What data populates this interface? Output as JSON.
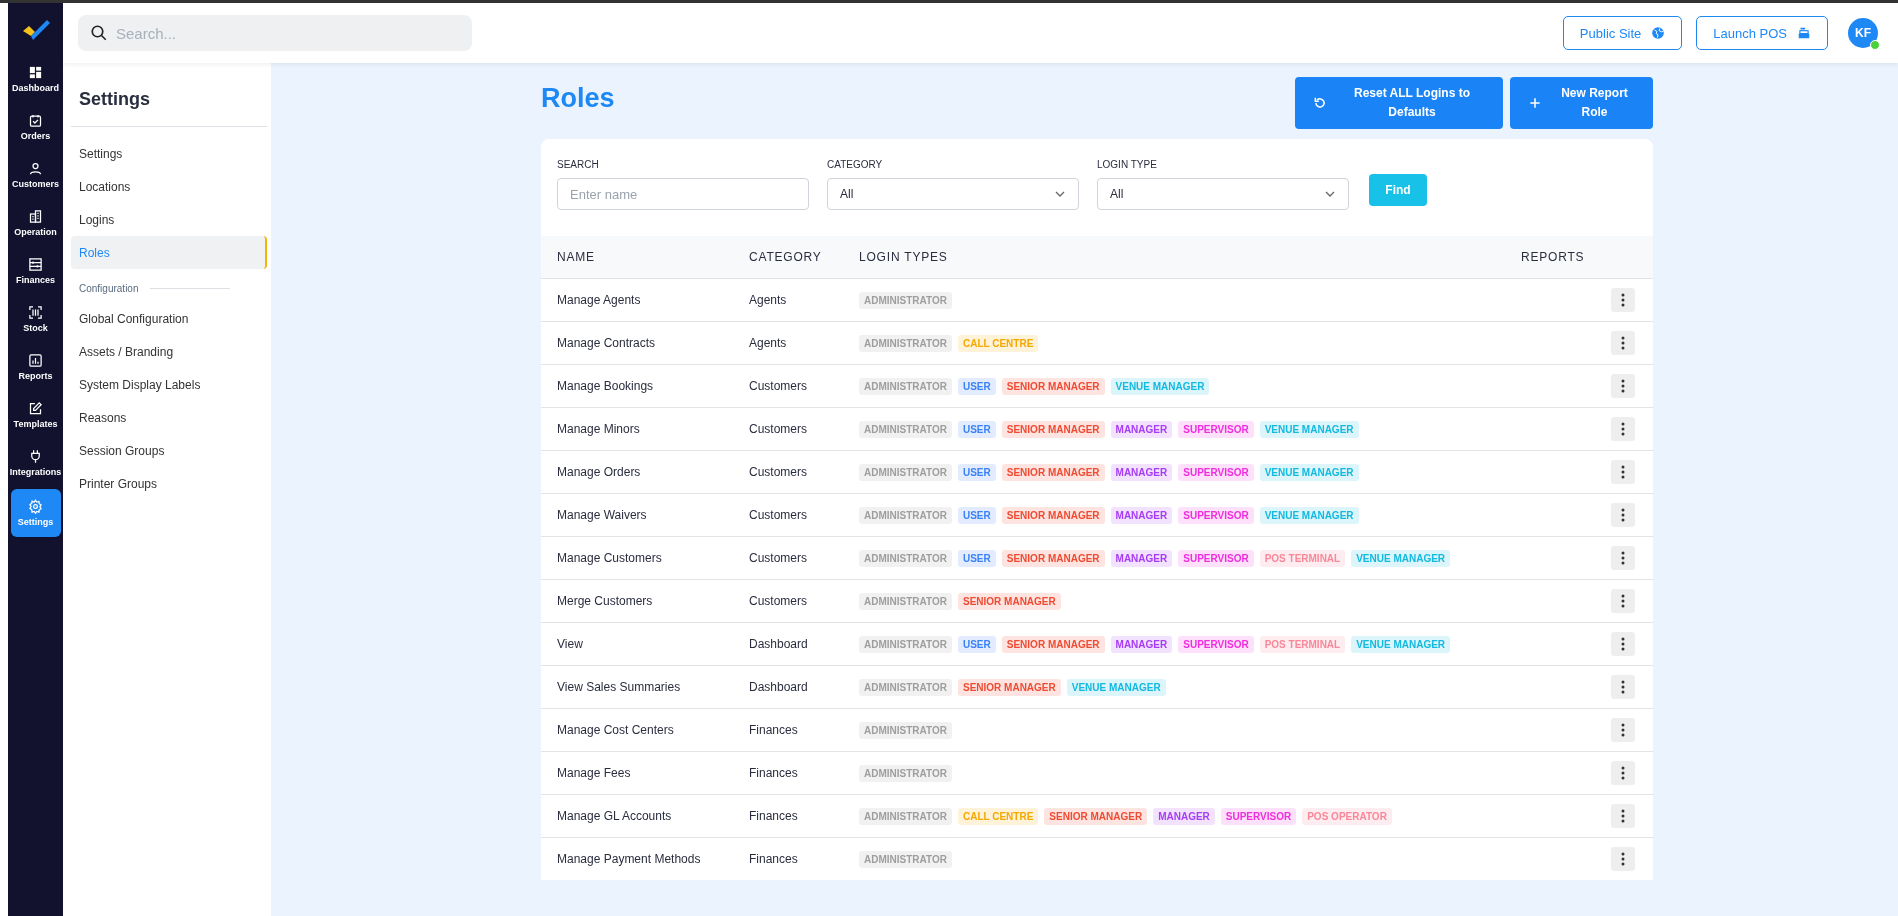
{
  "rail": {
    "items": [
      {
        "label": "Dashboard",
        "selected": false
      },
      {
        "label": "Orders",
        "selected": false
      },
      {
        "label": "Customers",
        "selected": false
      },
      {
        "label": "Operation",
        "selected": false
      },
      {
        "label": "Finances",
        "selected": false
      },
      {
        "label": "Stock",
        "selected": false
      },
      {
        "label": "Reports",
        "selected": false
      },
      {
        "label": "Templates",
        "selected": false
      },
      {
        "label": "Integrations",
        "selected": false
      },
      {
        "label": "Settings",
        "selected": true
      }
    ]
  },
  "search": {
    "placeholder": "Search..."
  },
  "top_actions": [
    {
      "label": "Public Site"
    },
    {
      "label": "Launch POS"
    }
  ],
  "avatar": {
    "initials": "KF",
    "online": true
  },
  "sidebar": {
    "title": "Settings",
    "groups": [
      {
        "items": [
          {
            "label": "Settings",
            "selected": false
          },
          {
            "label": "Locations",
            "selected": false
          },
          {
            "label": "Logins",
            "selected": false
          },
          {
            "label": "Roles",
            "selected": true
          }
        ]
      },
      {
        "heading": "Configuration",
        "items": [
          {
            "label": "Global Configuration",
            "selected": false
          },
          {
            "label": "Assets / Branding",
            "selected": false
          },
          {
            "label": "System Display Labels",
            "selected": false
          },
          {
            "label": "Reasons",
            "selected": false
          },
          {
            "label": "Session Groups",
            "selected": false
          },
          {
            "label": "Printer Groups",
            "selected": false
          }
        ]
      }
    ]
  },
  "page": {
    "title": "Roles",
    "actions": [
      {
        "label": "Reset ALL Logins to Defaults"
      },
      {
        "label": "New Report Role"
      }
    ]
  },
  "filters": {
    "fields": [
      {
        "kind": "text",
        "label": "SEARCH",
        "placeholder": "Enter name"
      },
      {
        "kind": "select",
        "label": "CATEGORY",
        "value": "All"
      },
      {
        "kind": "select",
        "label": "LOGIN TYPE",
        "value": "All"
      }
    ],
    "button": "Find"
  },
  "table": {
    "columns": [
      "NAME",
      "CATEGORY",
      "LOGIN TYPES",
      "REPORTS"
    ],
    "rows": [
      {
        "name": "Manage Agents",
        "category": "Agents",
        "login_types": [
          {
            "label": "ADMINISTRATOR",
            "color": "#9e9e9e"
          }
        ]
      },
      {
        "name": "Manage Contracts",
        "category": "Agents",
        "login_types": [
          {
            "label": "ADMINISTRATOR",
            "color": "#9e9e9e"
          },
          {
            "label": "CALL CENTRE",
            "color": "#f5a800"
          }
        ]
      },
      {
        "name": "Manage Bookings",
        "category": "Customers",
        "login_types": [
          {
            "label": "ADMINISTRATOR",
            "color": "#9e9e9e"
          },
          {
            "label": "USER",
            "color": "#3b82f6"
          },
          {
            "label": "SENIOR MANAGER",
            "color": "#f04b32"
          },
          {
            "label": "VENUE MANAGER",
            "color": "#12b9e0"
          }
        ]
      },
      {
        "name": "Manage Minors",
        "category": "Customers",
        "login_types": [
          {
            "label": "ADMINISTRATOR",
            "color": "#9e9e9e"
          },
          {
            "label": "USER",
            "color": "#3b82f6"
          },
          {
            "label": "SENIOR MANAGER",
            "color": "#f04b32"
          },
          {
            "label": "MANAGER",
            "color": "#a63cf5"
          },
          {
            "label": "SUPERVISOR",
            "color": "#f02ee0"
          },
          {
            "label": "VENUE MANAGER",
            "color": "#12b9e0"
          }
        ]
      },
      {
        "name": "Manage Orders",
        "category": "Customers",
        "login_types": [
          {
            "label": "ADMINISTRATOR",
            "color": "#9e9e9e"
          },
          {
            "label": "USER",
            "color": "#3b82f6"
          },
          {
            "label": "SENIOR MANAGER",
            "color": "#f04b32"
          },
          {
            "label": "MANAGER",
            "color": "#a63cf5"
          },
          {
            "label": "SUPERVISOR",
            "color": "#f02ee0"
          },
          {
            "label": "VENUE MANAGER",
            "color": "#12b9e0"
          }
        ]
      },
      {
        "name": "Manage Waivers",
        "category": "Customers",
        "login_types": [
          {
            "label": "ADMINISTRATOR",
            "color": "#9e9e9e"
          },
          {
            "label": "USER",
            "color": "#3b82f6"
          },
          {
            "label": "SENIOR MANAGER",
            "color": "#f04b32"
          },
          {
            "label": "MANAGER",
            "color": "#a63cf5"
          },
          {
            "label": "SUPERVISOR",
            "color": "#f02ee0"
          },
          {
            "label": "VENUE MANAGER",
            "color": "#12b9e0"
          }
        ]
      },
      {
        "name": "Manage Customers",
        "category": "Customers",
        "login_types": [
          {
            "label": "ADMINISTRATOR",
            "color": "#9e9e9e"
          },
          {
            "label": "USER",
            "color": "#3b82f6"
          },
          {
            "label": "SENIOR MANAGER",
            "color": "#f04b32"
          },
          {
            "label": "MANAGER",
            "color": "#a63cf5"
          },
          {
            "label": "SUPERVISOR",
            "color": "#f02ee0"
          },
          {
            "label": "POS TERMINAL",
            "color": "#f9879a"
          },
          {
            "label": "VENUE MANAGER",
            "color": "#12b9e0"
          }
        ]
      },
      {
        "name": "Merge Customers",
        "category": "Customers",
        "login_types": [
          {
            "label": "ADMINISTRATOR",
            "color": "#9e9e9e"
          },
          {
            "label": "SENIOR MANAGER",
            "color": "#f04b32"
          }
        ]
      },
      {
        "name": "View",
        "category": "Dashboard",
        "login_types": [
          {
            "label": "ADMINISTRATOR",
            "color": "#9e9e9e"
          },
          {
            "label": "USER",
            "color": "#3b82f6"
          },
          {
            "label": "SENIOR MANAGER",
            "color": "#f04b32"
          },
          {
            "label": "MANAGER",
            "color": "#a63cf5"
          },
          {
            "label": "SUPERVISOR",
            "color": "#f02ee0"
          },
          {
            "label": "POS TERMINAL",
            "color": "#f9879a"
          },
          {
            "label": "VENUE MANAGER",
            "color": "#12b9e0"
          }
        ]
      },
      {
        "name": "View Sales Summaries",
        "category": "Dashboard",
        "login_types": [
          {
            "label": "ADMINISTRATOR",
            "color": "#9e9e9e"
          },
          {
            "label": "SENIOR MANAGER",
            "color": "#f04b32"
          },
          {
            "label": "VENUE MANAGER",
            "color": "#12b9e0"
          }
        ]
      },
      {
        "name": "Manage Cost Centers",
        "category": "Finances",
        "login_types": [
          {
            "label": "ADMINISTRATOR",
            "color": "#9e9e9e"
          }
        ]
      },
      {
        "name": "Manage Fees",
        "category": "Finances",
        "login_types": [
          {
            "label": "ADMINISTRATOR",
            "color": "#9e9e9e"
          }
        ]
      },
      {
        "name": "Manage GL Accounts",
        "category": "Finances",
        "login_types": [
          {
            "label": "ADMINISTRATOR",
            "color": "#9e9e9e"
          },
          {
            "label": "CALL CENTRE",
            "color": "#f5a800"
          },
          {
            "label": "SENIOR MANAGER",
            "color": "#f04b32"
          },
          {
            "label": "MANAGER",
            "color": "#a63cf5"
          },
          {
            "label": "SUPERVISOR",
            "color": "#f02ee0"
          },
          {
            "label": "POS OPERATOR",
            "color": "#f9879a"
          }
        ]
      },
      {
        "name": "Manage Payment Methods",
        "category": "Finances",
        "login_types": [
          {
            "label": "ADMINISTRATOR",
            "color": "#9e9e9e"
          }
        ]
      }
    ]
  }
}
